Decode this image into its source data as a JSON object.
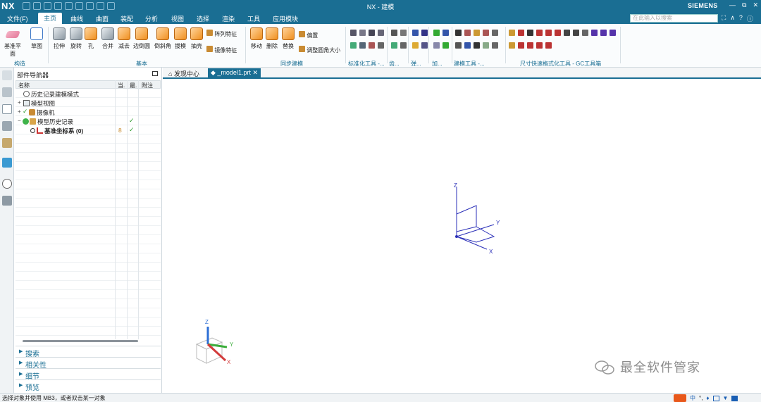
{
  "app": {
    "logo": "NX",
    "title": "NX - 建模",
    "brand": "SIEMENS",
    "window_buttons": [
      "—",
      "⧉",
      "✕"
    ]
  },
  "quick_access_icons": [
    "save-icon",
    "undo-icon",
    "redo-icon",
    "cut-icon",
    "copy-icon",
    "paste-icon",
    "repeat-icon",
    "touch-mode-icon",
    "window-switch-icon"
  ],
  "menubar": {
    "items": [
      "文件(F)",
      "主页",
      "曲线",
      "曲面",
      "装配",
      "分析",
      "视图",
      "选择",
      "渲染",
      "工具",
      "应用模块"
    ],
    "active": "主页",
    "search_placeholder": "在此输入以搜索",
    "right_icons": [
      "⛶",
      "∧",
      "?",
      "ⓘ"
    ]
  },
  "ribbon": {
    "construct": {
      "label": "构造",
      "buttons": [
        "基准平面",
        "草图"
      ]
    },
    "basic": {
      "label": "基本",
      "buttons": [
        "拉伸",
        "旋转",
        "孔",
        "合并",
        "减去",
        "边倒圆",
        "倒斜角",
        "拔模",
        "抽壳"
      ],
      "side": [
        "阵列特征",
        "镜像特征"
      ]
    },
    "sync": {
      "label": "同步建模",
      "buttons": [
        "移动",
        "删除",
        "替换"
      ],
      "side": [
        "偏置",
        "调整圆角大小"
      ]
    },
    "small_groups": [
      "标准化工具 -...",
      "齿...",
      "弹...",
      "加...",
      "建模工具 -...",
      "尺寸快速格式化工具 - GC工具箱"
    ]
  },
  "navigator": {
    "title": "部件导航器",
    "columns": [
      "名称",
      "当.",
      "最.",
      "附注"
    ],
    "rows": [
      {
        "expander": "",
        "label": "历史记录建模模式",
        "icon": "clock-icon",
        "current": "",
        "latest": false
      },
      {
        "expander": "+",
        "label": "模型视图",
        "icon": "model-view-icon",
        "current": "",
        "latest": false
      },
      {
        "expander": "+",
        "label": "摄像机",
        "icon": "camera-icon",
        "current": "",
        "latest": false
      },
      {
        "expander": "−",
        "label": "模型历史记录",
        "icon": "history-icon",
        "current": "",
        "latest": true
      },
      {
        "expander": "",
        "label": "基准坐标系 (0)",
        "icon": "datum-csys-icon",
        "current": "8",
        "latest": true
      }
    ],
    "panels": [
      "搜索",
      "相关性",
      "细节",
      "预览"
    ]
  },
  "tabs": [
    {
      "label": "发现中心",
      "icon": "home-icon"
    },
    {
      "label": "_model1.prt",
      "icon": "part-icon",
      "active": true
    }
  ],
  "viewport": {
    "axes": [
      "Z",
      "Y",
      "X"
    ],
    "triad_axes": [
      "Z",
      "Y",
      "X"
    ]
  },
  "statusbar": {
    "message": "选择对象并使用 MB3，或者双击某一对象",
    "ime_label": "中"
  },
  "watermark": "最全软件管家",
  "colors": {
    "titlebar": "#1a6e93",
    "accent": "#1a6e93",
    "datum": "#2a2fb8",
    "check": "#2f9b2f"
  }
}
